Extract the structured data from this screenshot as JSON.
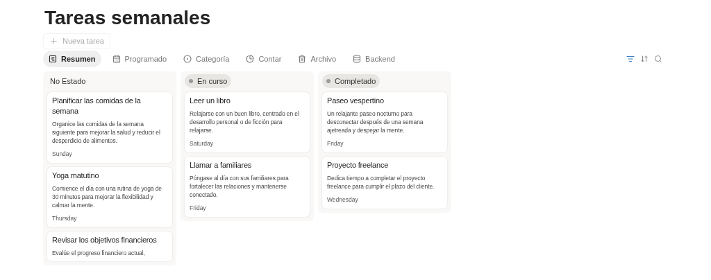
{
  "title": "Tareas semanales",
  "new_task": {
    "label": "Nueva tarea"
  },
  "tabs": [
    {
      "label": "Resumen",
      "selected": true
    },
    {
      "label": "Programado",
      "selected": false
    },
    {
      "label": "Categoría",
      "selected": false
    },
    {
      "label": "Contar",
      "selected": false
    },
    {
      "label": "Archivo",
      "selected": false
    },
    {
      "label": "Backend",
      "selected": false
    }
  ],
  "columns": [
    {
      "title": "No Estado",
      "kind": "plain",
      "cards": [
        {
          "title": "Planificar las comidas de la semana",
          "description": "Organice las comidas de la semana siguiente para mejorar la salud y reducir el desperdicio de alimentos.",
          "day": "Sunday"
        },
        {
          "title": "Yoga matutino",
          "description": "Comience el día con una rutina de yoga de 30 minutos para mejorar la flexibilidad y calmar la mente.",
          "day": "Thursday"
        },
        {
          "title": "Revisar los objetivos financieros",
          "description": "Evalúe el progreso financiero actual,"
        }
      ]
    },
    {
      "title": "En curso",
      "kind": "pill",
      "cards": [
        {
          "title": "Leer un libro",
          "description": "Relajarse con un buen libro, centrado en el desarrollo personal o de ficción para relajarse.",
          "day": "Saturday"
        },
        {
          "title": "Llamar a familiares",
          "description": "Póngase al día con sus familiares para fortalecer las relaciones y mantenerse conectado.",
          "day": "Friday"
        }
      ]
    },
    {
      "title": "Completado",
      "kind": "pill",
      "cards": [
        {
          "title": "Paseo vespertino",
          "description": "Un relajante paseo nocturno para desconectar después de una semana ajetreada y despejar la mente.",
          "day": "Friday"
        },
        {
          "title": "Proyecto freelance",
          "description": "Dedica tiempo a completar el proyecto freelance para cumplir el plazo del cliente.",
          "day": "Wednesday"
        }
      ]
    }
  ]
}
